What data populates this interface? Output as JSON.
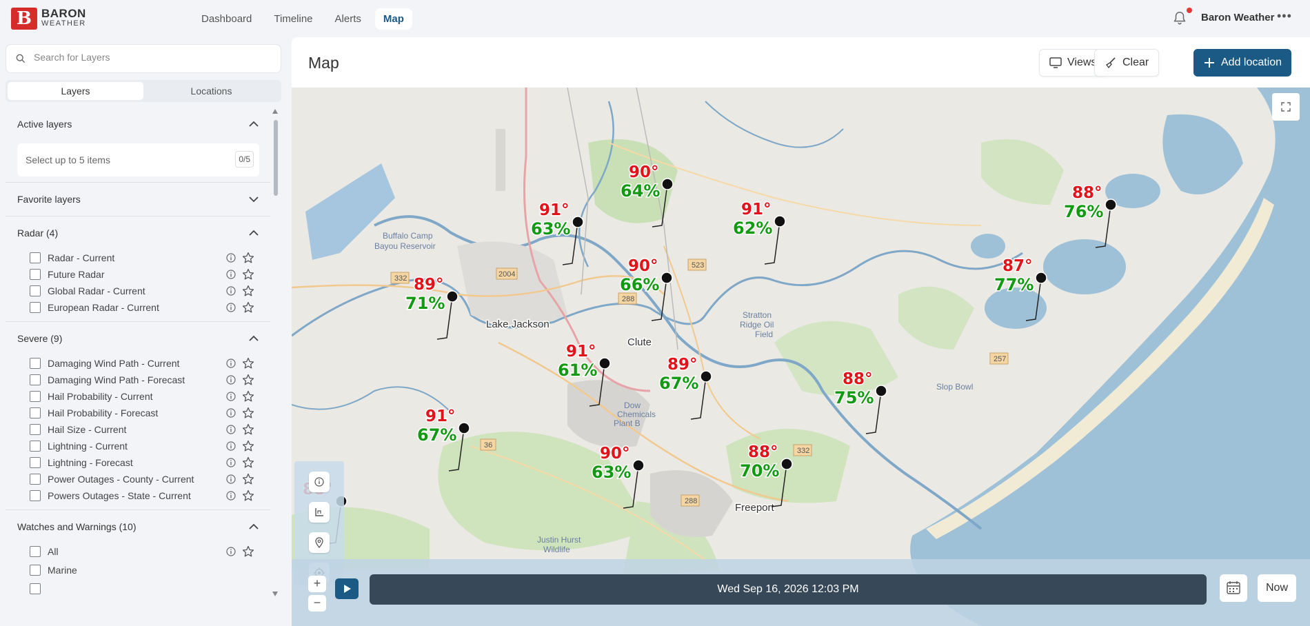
{
  "brand": {
    "name_line1": "BARON",
    "name_line2": "WEATHER"
  },
  "nav": [
    {
      "label": "Dashboard",
      "active": false
    },
    {
      "label": "Timeline",
      "active": false
    },
    {
      "label": "Alerts",
      "active": false
    },
    {
      "label": "Map",
      "active": true
    }
  ],
  "header": {
    "username": "Baron Weather",
    "more_icon": "ellipsis-icon",
    "bell_icon": "bell-icon"
  },
  "left": {
    "search_placeholder": "Search for Layers",
    "tabs": [
      "Layers",
      "Locations"
    ],
    "active_layers": {
      "title": "Active layers",
      "placeholder": "Select up to 5 items",
      "count": "0/5"
    },
    "favorite_title": "Favorite layers",
    "radar": {
      "title": "Radar (4)",
      "items": [
        "Radar - Current",
        "Future Radar",
        "Global Radar - Current",
        "European Radar - Current"
      ]
    },
    "severe": {
      "title": "Severe (9)",
      "items": [
        "Damaging Wind Path - Current",
        "Damaging Wind Path - Forecast",
        "Hail Probability - Current",
        "Hail Probability - Forecast",
        "Hail Size - Current",
        "Lightning - Current",
        "Lightning - Forecast",
        "Power Outages - County - Current",
        "Powers Outages - State - Current"
      ]
    },
    "watches": {
      "title": "Watches and Warnings (10)",
      "items": [
        "All",
        "Marine"
      ]
    }
  },
  "main": {
    "title": "Map",
    "views_label": "Views",
    "clear_label": "Clear",
    "add_label": "Add location"
  },
  "map": {
    "labels": [
      "Lake Jackson",
      "Clute",
      "Freeport",
      "Buffalo Camp",
      "Bayou Reservoir",
      "Dow",
      "Chemicals",
      "Plant B",
      "Justin Hurst",
      "Wildlife",
      "Slop Bowl",
      "Stratton",
      "Ridge Oil",
      "Field"
    ],
    "road_labels": [
      "332",
      "2004",
      "288",
      "523",
      "257",
      "332",
      "36",
      "288"
    ],
    "stations": [
      {
        "temp": "90°",
        "hum": "64%"
      },
      {
        "temp": "91°",
        "hum": "63%"
      },
      {
        "temp": "91°",
        "hum": "62%"
      },
      {
        "temp": "88°",
        "hum": "76%"
      },
      {
        "temp": "89°",
        "hum": "71%"
      },
      {
        "temp": "90°",
        "hum": "66%"
      },
      {
        "temp": "87°",
        "hum": "77%"
      },
      {
        "temp": "91°",
        "hum": "61%"
      },
      {
        "temp": "89°",
        "hum": "67%"
      },
      {
        "temp": "88°",
        "hum": "75%"
      },
      {
        "temp": "91°",
        "hum": "67%"
      },
      {
        "temp": "90°",
        "hum": "63%"
      },
      {
        "temp": "88°",
        "hum": "70%"
      },
      {
        "temp": "88°",
        "hum": ""
      }
    ]
  },
  "timebar": {
    "datetime": "Wed Sep 16, 2026 12:03 PM",
    "now_label": "Now",
    "zoom_in": "+",
    "zoom_out": "−"
  },
  "colors": {
    "accent": "#1a5a84",
    "timeline": "#374859",
    "temp": "#e0141a",
    "humidity": "#139a13",
    "water": "#9ec1d8"
  }
}
